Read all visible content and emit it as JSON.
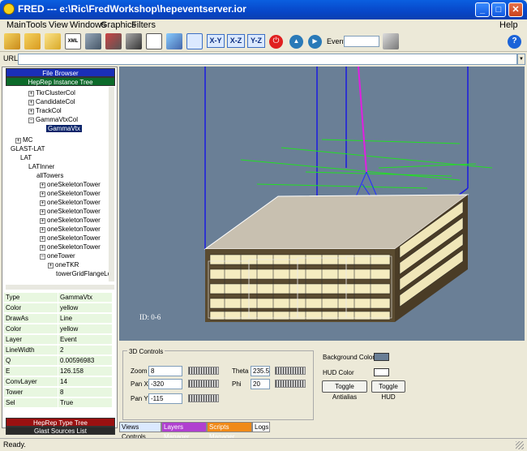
{
  "window": {
    "title": "FRED --- e:\\Ric\\FredWorkshop\\hepeventserver.ior",
    "min": "_",
    "max": "□",
    "close": "✕"
  },
  "menu": {
    "items": [
      "Main",
      "Tools",
      "View",
      "Windows",
      "Graphics",
      "Filters"
    ],
    "help": "Help"
  },
  "toolbar": {
    "axes": [
      "X-Y",
      "X-Z",
      "Y-Z"
    ],
    "event_label": "Event",
    "event_value": ""
  },
  "url": {
    "label": "URL:",
    "value": ""
  },
  "left": {
    "file_browser": "File Browser",
    "instance_tree": "HepRep Instance Tree",
    "type_tree": "HepRep Type Tree",
    "sources": "Glast Sources List",
    "tree": [
      {
        "text": "TkrClusterCol",
        "pm": "+"
      },
      {
        "text": "CandidateCol",
        "pm": "+"
      },
      {
        "text": "TrackCol",
        "pm": "+"
      },
      {
        "text": "GammaVtxCol",
        "pm": "−"
      },
      {
        "text": "GammaVtx",
        "pm": ""
      },
      {
        "text": "MC",
        "pm": "+"
      },
      {
        "text": "GLAST-LAT",
        "pm": ""
      },
      {
        "text": "LAT",
        "pm": ""
      },
      {
        "text": "LATInner",
        "pm": ""
      },
      {
        "text": "allTowers",
        "pm": ""
      },
      {
        "text": "oneSkeletonTower",
        "pm": "+"
      },
      {
        "text": "oneSkeletonTower",
        "pm": "+"
      },
      {
        "text": "oneSkeletonTower",
        "pm": "+"
      },
      {
        "text": "oneSkeletonTower",
        "pm": "+"
      },
      {
        "text": "oneSkeletonTower",
        "pm": "+"
      },
      {
        "text": "oneSkeletonTower",
        "pm": "+"
      },
      {
        "text": "oneSkeletonTower",
        "pm": "+"
      },
      {
        "text": "oneSkeletonTower",
        "pm": "+"
      },
      {
        "text": "oneTower",
        "pm": "−"
      },
      {
        "text": "oneTKR",
        "pm": "+"
      },
      {
        "text": "towerGridFlangeLong",
        "pm": ""
      }
    ],
    "props": [
      {
        "k": "Type",
        "v": "GammaVtx"
      },
      {
        "k": "Color",
        "v": "yellow"
      },
      {
        "k": "DrawAs",
        "v": "Line"
      },
      {
        "k": "Color",
        "v": "yellow"
      },
      {
        "k": "Layer",
        "v": "Event"
      },
      {
        "k": "LineWidth",
        "v": "2"
      },
      {
        "k": "Q",
        "v": "0.00596983"
      },
      {
        "k": "E",
        "v": "126.158"
      },
      {
        "k": "ConvLayer",
        "v": "14"
      },
      {
        "k": "Tower",
        "v": "8"
      },
      {
        "k": "Sel",
        "v": "True"
      }
    ]
  },
  "view": {
    "id_label": "ID: 0-6"
  },
  "controls": {
    "group": "3D Controls",
    "zoom_label": "Zoom",
    "zoom": "8",
    "panx_label": "Pan X",
    "panx": "-320",
    "pany_label": "Pan Y",
    "pany": "-115",
    "theta_label": "Theta",
    "theta": "235.5",
    "phi_label": "Phi",
    "phi": "20",
    "bg_label": "Background Color",
    "hud_label": "HUD Color",
    "antialias": "Toggle Antialias",
    "toggle_hud": "Toggle HUD"
  },
  "tabs": [
    "Views Controls",
    "Layers Manager",
    "Scripts Manager",
    "Logs"
  ],
  "status": "Ready.",
  "colors": {
    "title": "#0a52d8",
    "view_bg": "#6a7f96",
    "hdr_blue": "#1a2fb8",
    "hdr_green": "#0c6a2a",
    "hdr_red": "#9a1010",
    "hdr_dark": "#2a2a2a"
  }
}
